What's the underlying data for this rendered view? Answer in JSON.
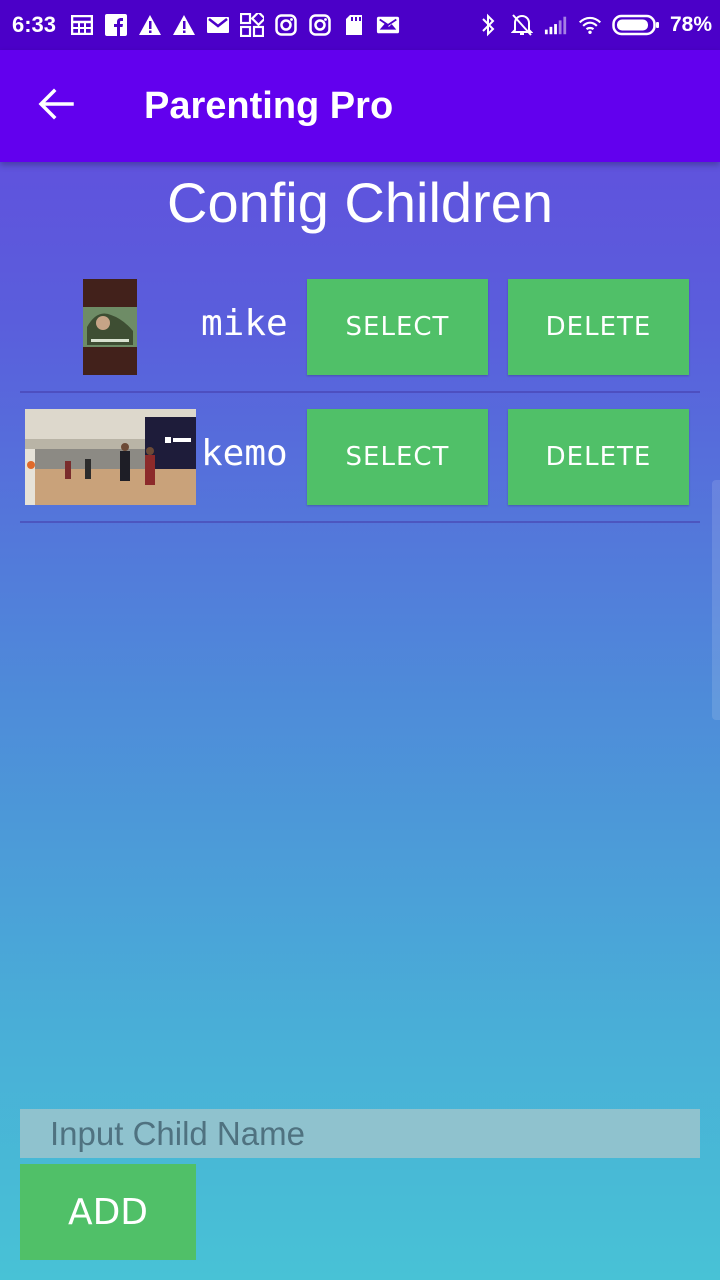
{
  "status_bar": {
    "time": "6:33",
    "battery_percent": "78%",
    "left_icons": [
      "calendar-icon",
      "facebook-icon",
      "warning-icon",
      "warning-icon",
      "gmail-icon",
      "apps-icon",
      "instagram-icon",
      "instagram-icon",
      "sd-card-icon",
      "photo-mail-icon"
    ],
    "right_icons": [
      "bluetooth-icon",
      "mute-icon",
      "signal-icon",
      "wifi-icon",
      "battery-icon"
    ]
  },
  "app_bar": {
    "title": "Parenting Pro",
    "back_icon": "arrow-left-icon"
  },
  "page": {
    "title": "Config Children",
    "children": [
      {
        "name": "mike",
        "select_label": "SELECT",
        "delete_label": "DELETE"
      },
      {
        "name": "kemo",
        "select_label": "SELECT",
        "delete_label": "DELETE"
      }
    ]
  },
  "form": {
    "input_placeholder": "Input Child Name",
    "input_value": "",
    "add_label": "ADD"
  },
  "colors": {
    "status_bar": "#4B00C8",
    "app_bar": "#6200EE",
    "button": "#50C068",
    "gradient_top": "#6547DE",
    "gradient_bottom": "#48C2D6"
  }
}
